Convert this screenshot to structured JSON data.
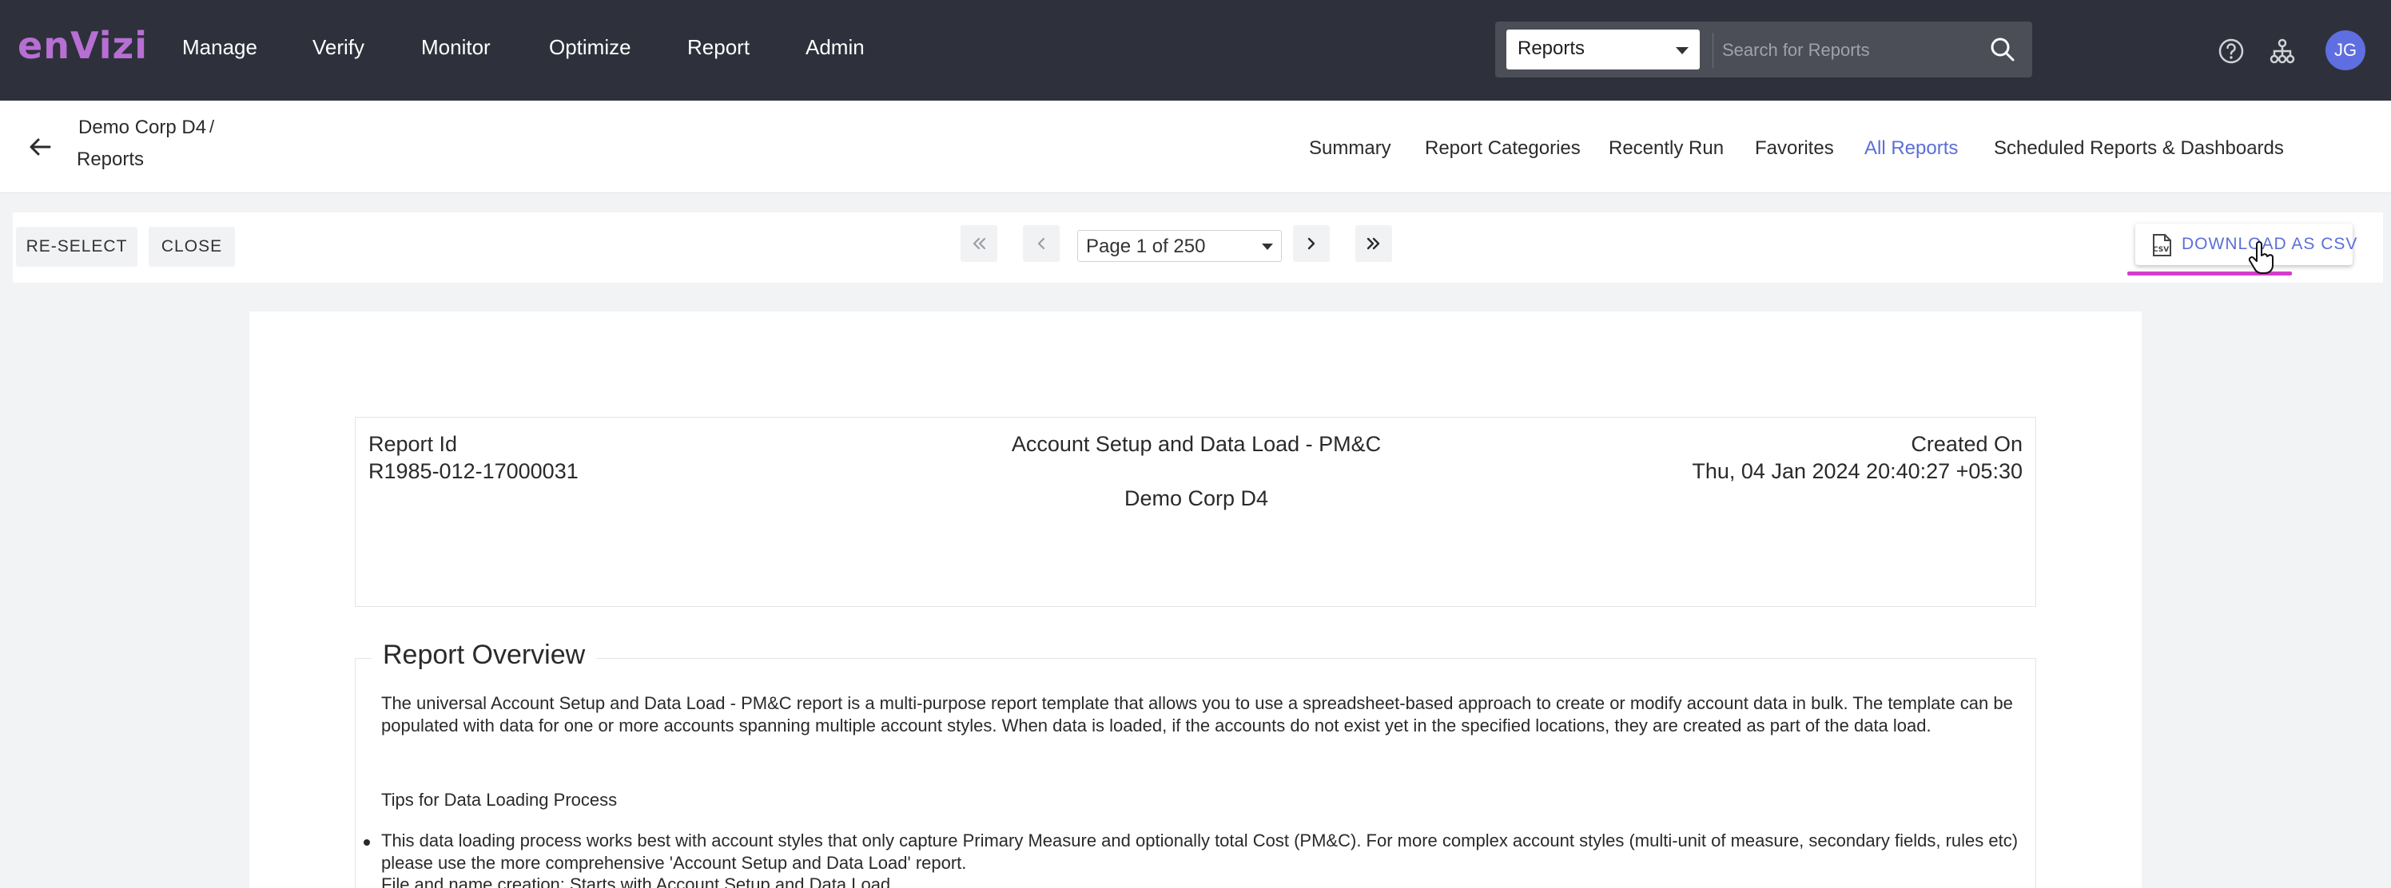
{
  "brand": {
    "logo_text": "enVizi"
  },
  "nav": {
    "items": [
      "Manage",
      "Verify",
      "Monitor",
      "Optimize",
      "Report",
      "Admin"
    ]
  },
  "search": {
    "scope_value": "Reports",
    "placeholder": "Search for Reports"
  },
  "user": {
    "initials": "JG"
  },
  "breadcrumb": {
    "parent": "Demo Corp D4",
    "separator": "/",
    "current": "Reports"
  },
  "tabs": [
    "Summary",
    "Report Categories",
    "Recently Run",
    "Favorites",
    "All Reports",
    "Scheduled Reports & Dashboards"
  ],
  "active_tab": "All Reports",
  "toolbar": {
    "reselect_label": "RE-SELECT",
    "close_label": "CLOSE",
    "page_value": "Page 1 of 250",
    "download_label": "DOWNLOAD AS CSV"
  },
  "report": {
    "id_label": "Report Id",
    "id_value": "R1985-012-17000031",
    "title": "Account Setup and Data Load - PM&C",
    "org": "Demo Corp D4",
    "created_label": "Created On",
    "created_value": "Thu, 04 Jan 2024 20:40:27 +05:30"
  },
  "overview": {
    "title": "Report Overview",
    "paragraph": "The universal Account Setup and Data Load - PM&C report is a multi-purpose report template that allows you to use a spreadsheet-based approach to create or modify account data in bulk. The template can be populated with data for one or more accounts spanning multiple account styles. When data is loaded, if the accounts do not exist yet in the specified locations, they are created as part of the data load.",
    "tips_heading": "Tips for Data Loading Process",
    "bullet_1": "This data loading process works best with account styles that only capture Primary Measure and optionally total Cost (PM&C). For more complex account styles (multi-unit of measure, secondary fields, rules etc) please use the more comprehensive 'Account Setup and Data Load' report.",
    "bullet_2_partial": "File and name creation: Starts with Account Setup and Data Load..."
  },
  "colors": {
    "topbar": "#2e313b",
    "accent": "#5b6fd6",
    "logo": "#b76fd3",
    "highlight": "#d63cc9"
  }
}
